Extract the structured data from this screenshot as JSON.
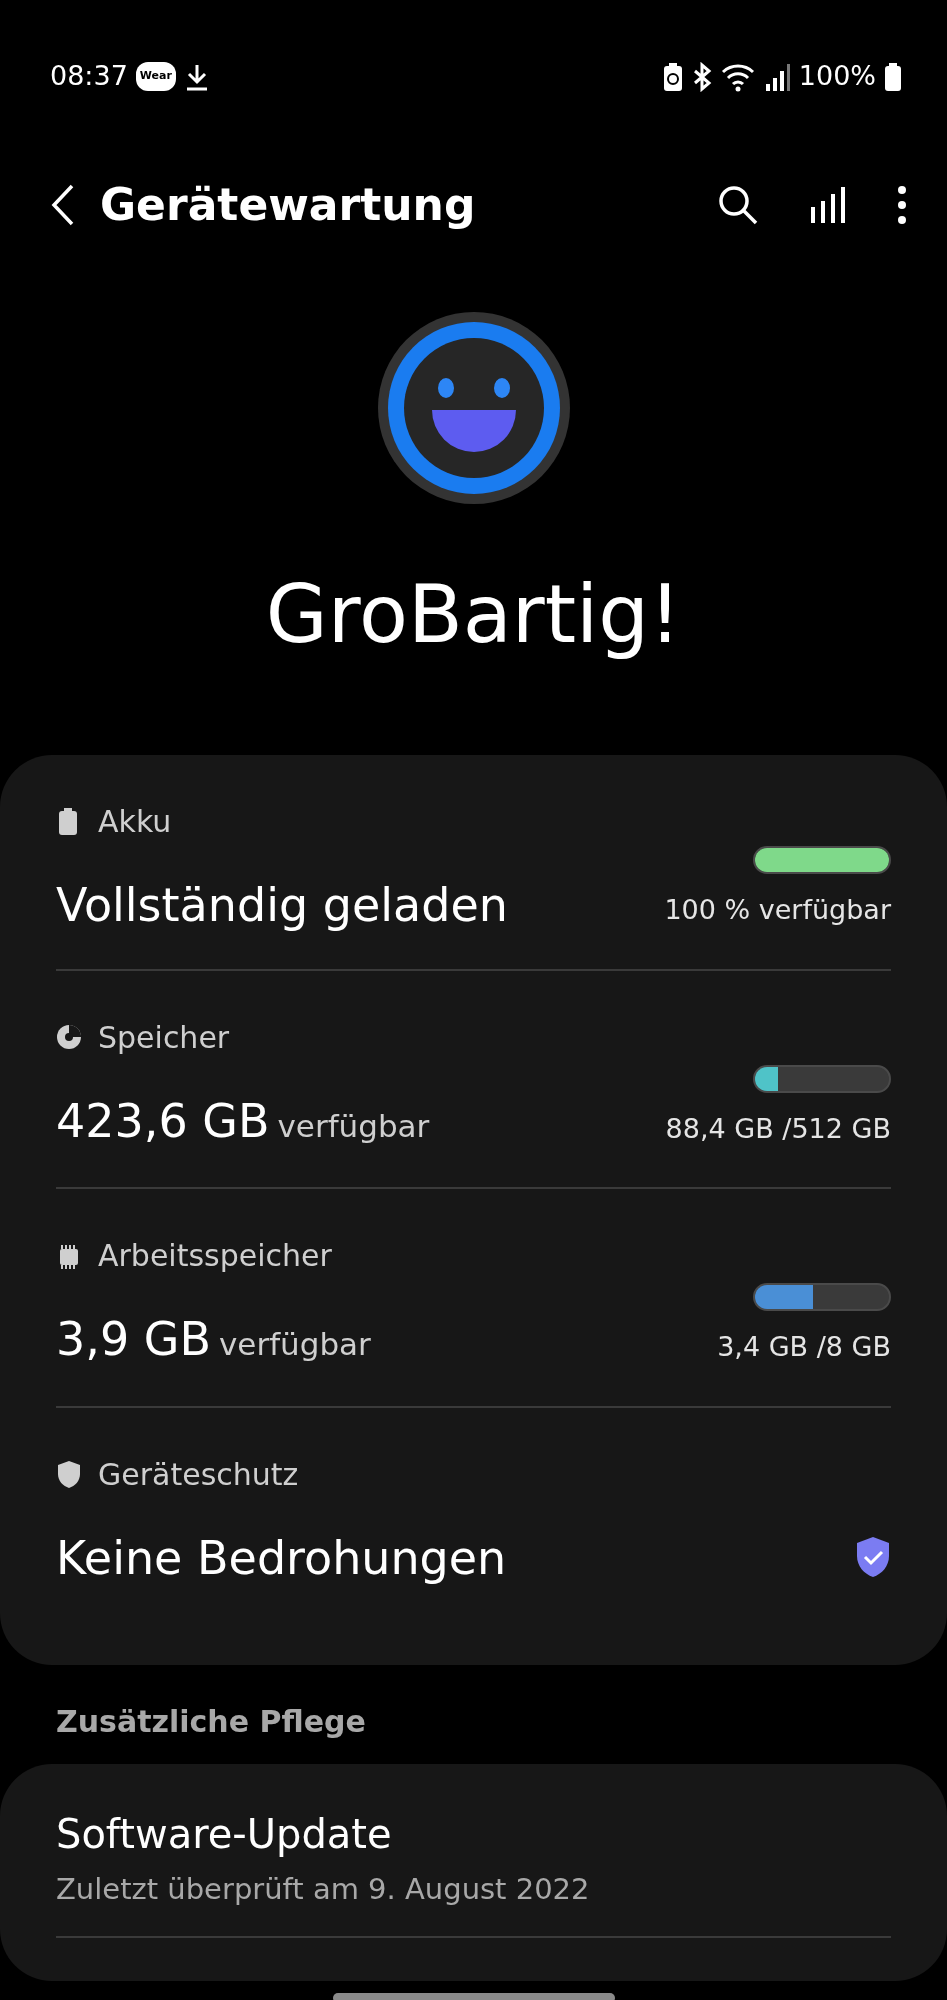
{
  "status_bar": {
    "time": "08:37",
    "badge": "Wear",
    "battery": "100%"
  },
  "header": {
    "title": "Gerätewartung"
  },
  "summary": {
    "headline": "GroBartig!"
  },
  "items": [
    {
      "kind": "meter",
      "label": "Akku",
      "value": "Vollständig geladen",
      "level": 1.0,
      "color": "#7fd98a",
      "reading": "100 % verfügbar"
    },
    {
      "kind": "meter",
      "label": "Speicher",
      "value": "423,6 GB",
      "suffix": "verfügbar",
      "level": 0.17,
      "color": "#4fc3c8",
      "reading": "88,4 GB /512 GB"
    },
    {
      "kind": "meter",
      "label": "Arbeitsspeicher",
      "value": "3,9 GB",
      "suffix": "verfügbar",
      "level": 0.43,
      "color": "#4a8fd6",
      "reading": "3,4 GB /8 GB"
    },
    {
      "kind": "status",
      "label": "Geräteschutz",
      "value": "Keine Bedrohungen",
      "verified": true
    }
  ],
  "extra": {
    "title": "Zusätzliche Pflege",
    "items": [
      {
        "title": "Software-Update",
        "subtitle": "Zuletzt überprüft am 9. August 2022"
      }
    ]
  }
}
